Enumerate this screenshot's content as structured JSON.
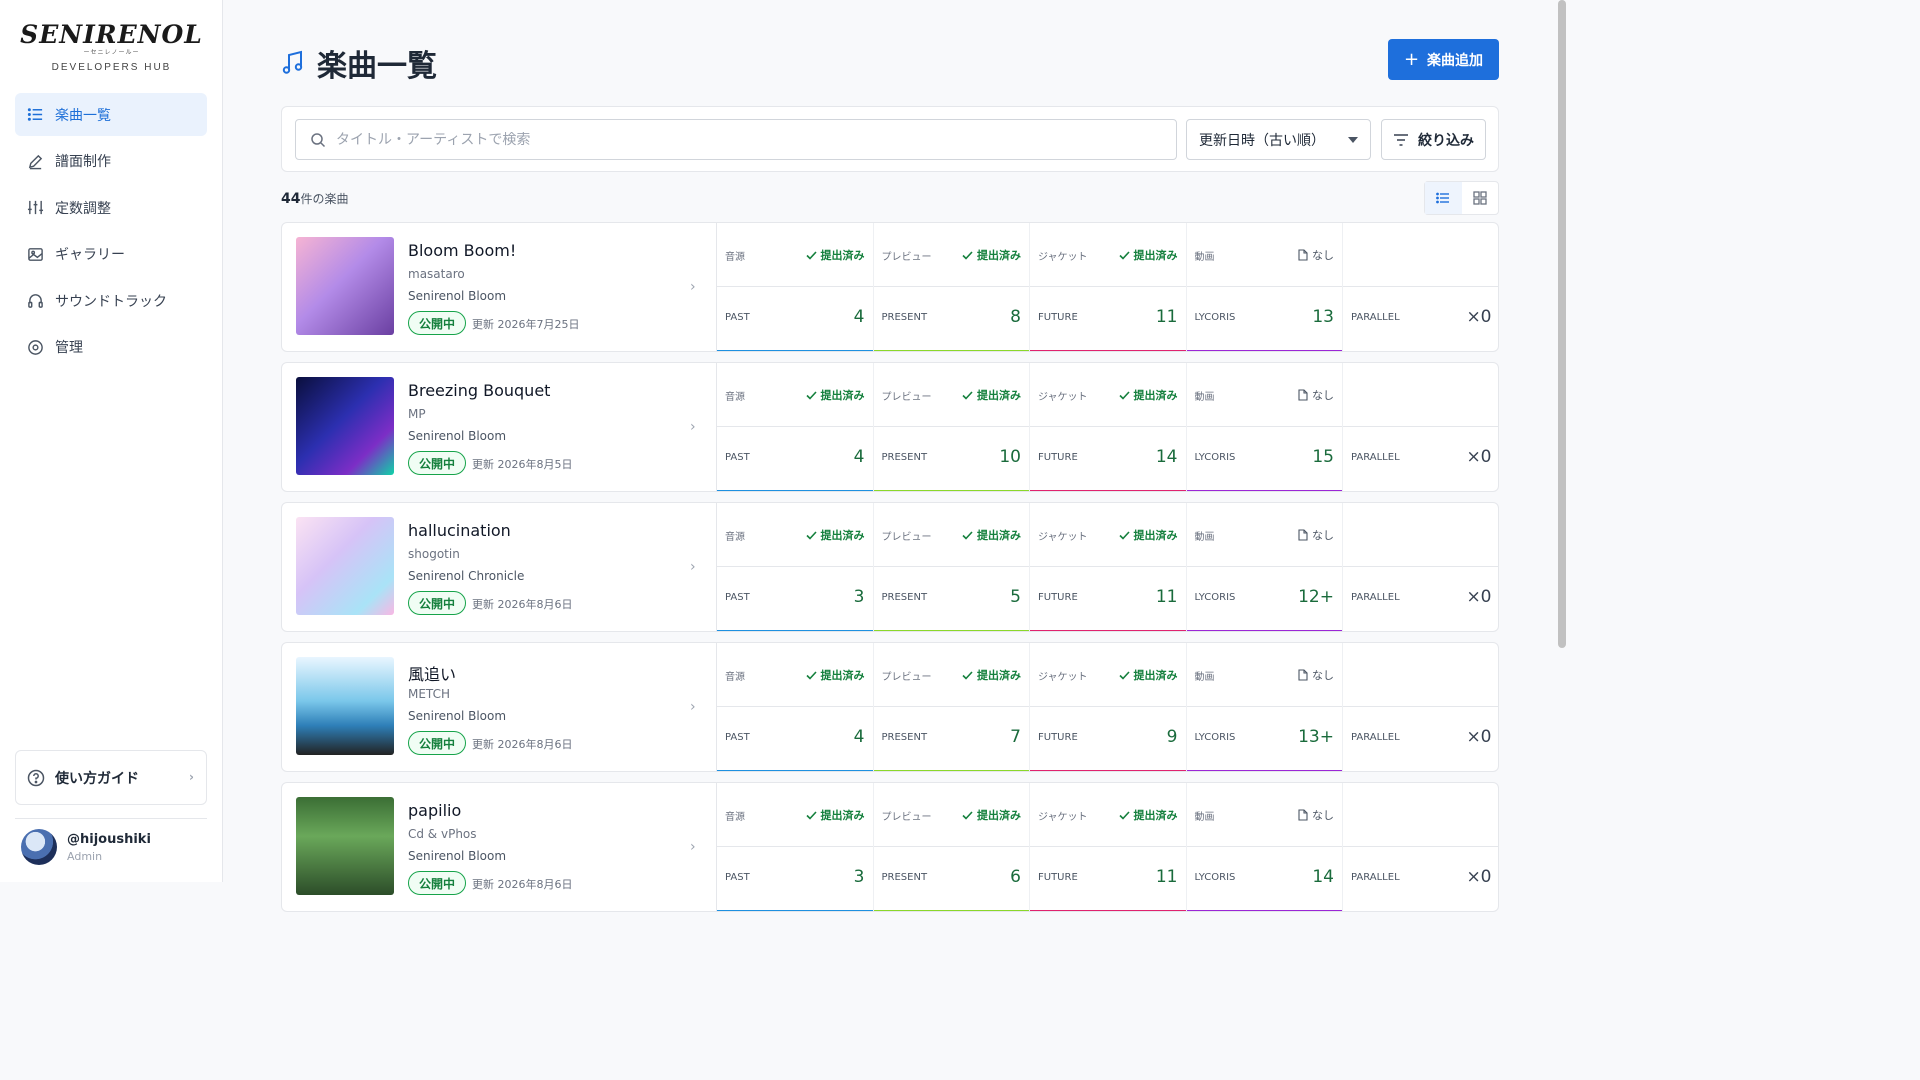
{
  "sidebar": {
    "logo_text": "SENIRENOL",
    "logo_subtext": "ーセニレノールー",
    "hub_label": "DEVELOPERS HUB",
    "nav": [
      {
        "label": "楽曲一覧",
        "icon": "list-icon",
        "active": true
      },
      {
        "label": "譜面制作",
        "icon": "pencil-icon",
        "active": false
      },
      {
        "label": "定数調整",
        "icon": "sliders-icon",
        "active": false
      },
      {
        "label": "ギャラリー",
        "icon": "image-icon",
        "active": false
      },
      {
        "label": "サウンドトラック",
        "icon": "headphones-icon",
        "active": false
      },
      {
        "label": "管理",
        "icon": "gear-icon",
        "active": false
      }
    ],
    "guide_label": "使い方ガイド",
    "user": {
      "name": "@hijoushiki",
      "role": "Admin"
    }
  },
  "header": {
    "title": "楽曲一覧",
    "add_button": "楽曲追加"
  },
  "filters": {
    "search_placeholder": "タイトル・アーティストで検索",
    "sort_value": "更新日時（古い順）",
    "filter_button": "絞り込み"
  },
  "list_meta": {
    "count": "44",
    "count_suffix": "件の楽曲"
  },
  "colors": {
    "accent": "#1e6fdc",
    "past": "#1e90e0",
    "present": "#8bd72a",
    "future": "#e0226e",
    "lycoris": "#9b27d6",
    "published": "#16a34a"
  },
  "asset_labels": [
    "音源",
    "プレビュー",
    "ジャケット",
    "動画"
  ],
  "diff_labels": [
    "PAST",
    "PRESENT",
    "FUTURE",
    "LYCORIS",
    "PARALLEL"
  ],
  "songs": [
    {
      "title": "Bloom Boom!",
      "artist": "masataro",
      "album": "Senirenol Bloom",
      "status": "公開中",
      "updated": "更新 2026年7月25日",
      "assets": [
        "提出済み",
        "提出済み",
        "提出済み",
        "なし"
      ],
      "diffs": [
        "4",
        "8",
        "11",
        "13",
        "×0"
      ]
    },
    {
      "title": "Breezing Bouquet",
      "artist": "MP",
      "album": "Senirenol Bloom",
      "status": "公開中",
      "updated": "更新 2026年8月5日",
      "assets": [
        "提出済み",
        "提出済み",
        "提出済み",
        "なし"
      ],
      "diffs": [
        "4",
        "10",
        "14",
        "15",
        "×0"
      ]
    },
    {
      "title": "hallucination",
      "artist": "shogotin",
      "album": "Senirenol Chronicle",
      "status": "公開中",
      "updated": "更新 2026年8月6日",
      "assets": [
        "提出済み",
        "提出済み",
        "提出済み",
        "なし"
      ],
      "diffs": [
        "3",
        "5",
        "11",
        "12+",
        "×0"
      ]
    },
    {
      "title": "風追い",
      "artist": "METCH",
      "album": "Senirenol Bloom",
      "status": "公開中",
      "updated": "更新 2026年8月6日",
      "assets": [
        "提出済み",
        "提出済み",
        "提出済み",
        "なし"
      ],
      "diffs": [
        "4",
        "7",
        "9",
        "13+",
        "×0"
      ]
    },
    {
      "title": "papilio",
      "artist": "Cd & vPhos",
      "album": "Senirenol Bloom",
      "status": "公開中",
      "updated": "更新 2026年8月6日",
      "assets": [
        "提出済み",
        "提出済み",
        "提出済み",
        "なし"
      ],
      "diffs": [
        "3",
        "6",
        "11",
        "14",
        "×0"
      ]
    }
  ]
}
